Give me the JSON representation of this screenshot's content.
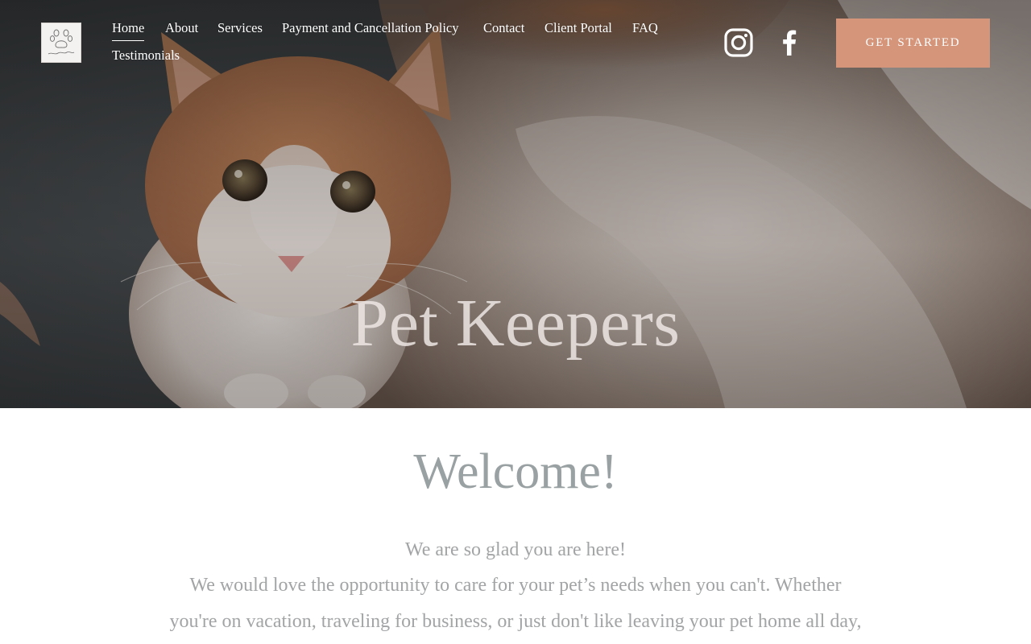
{
  "header": {
    "logo_alt": "Pet Keepers",
    "nav": [
      {
        "label": "Home",
        "active": true
      },
      {
        "label": "About"
      },
      {
        "label": "Services"
      },
      {
        "label": "Payment and Cancellation Policy"
      },
      {
        "label": "Contact"
      },
      {
        "label": "Client Portal"
      },
      {
        "label": "FAQ"
      },
      {
        "label": "Testimonials"
      }
    ],
    "social": [
      {
        "icon": "instagram-icon"
      },
      {
        "icon": "facebook-icon"
      }
    ],
    "cta_label": "GET STARTED"
  },
  "hero": {
    "title": "Pet Keepers"
  },
  "main": {
    "welcome_title": "Welcome!",
    "lines": [
      "We are so glad you are here!",
      "We would love the opportunity to care for your pet’s needs when you can't. Whether",
      "you're on vacation, traveling for business, or just don't like leaving your pet home all day,"
    ]
  },
  "colors": {
    "cta_background": "#d4957a",
    "welcome_text": "#9aa1a2",
    "body_text": "#a2a4a5",
    "nav_text": "#ffffff"
  }
}
